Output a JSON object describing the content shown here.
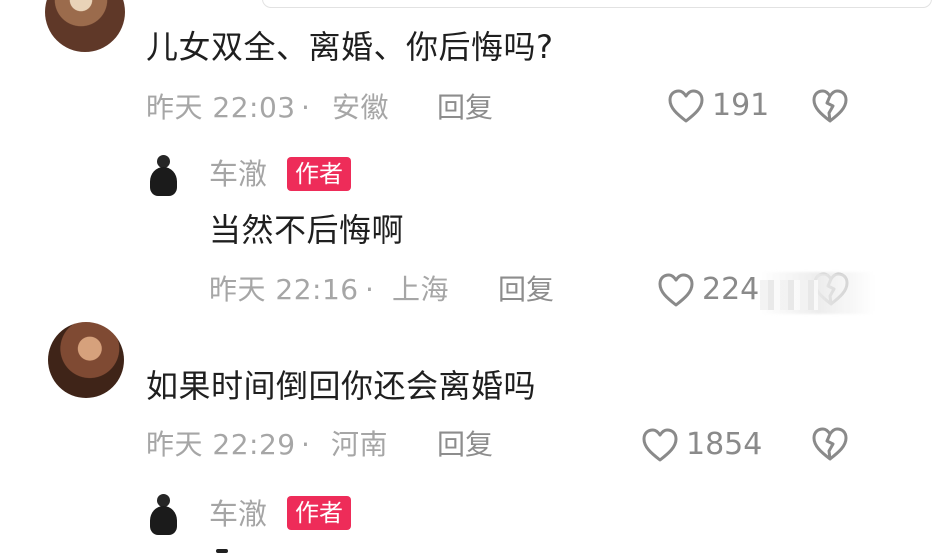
{
  "comments": [
    {
      "text": "儿女双全、离婚、你后悔吗?",
      "time": "昨天 22:03",
      "location": "安徽",
      "reply_label": "回复",
      "likes": "191",
      "icons": {
        "like": "heart-icon",
        "dislike": "broken-heart-icon"
      },
      "author_reply": {
        "name": "车澈",
        "badge": "作者",
        "text": "当然不后悔啊",
        "time": "昨天 22:16",
        "location": "上海",
        "reply_label": "回复",
        "likes": "224"
      }
    },
    {
      "text": "如果时间倒回你还会离婚吗",
      "time": "昨天 22:29",
      "location": "河南",
      "reply_label": "回复",
      "likes": "1854",
      "icons": {
        "like": "heart-icon",
        "dislike": "broken-heart-icon"
      },
      "author_reply": {
        "name": "车澈",
        "badge": "作者"
      }
    }
  ],
  "separator": "·",
  "colors": {
    "badge": "#ee2c59",
    "primary_text": "#1f1f1f",
    "secondary_text": "#a6a6a6"
  }
}
